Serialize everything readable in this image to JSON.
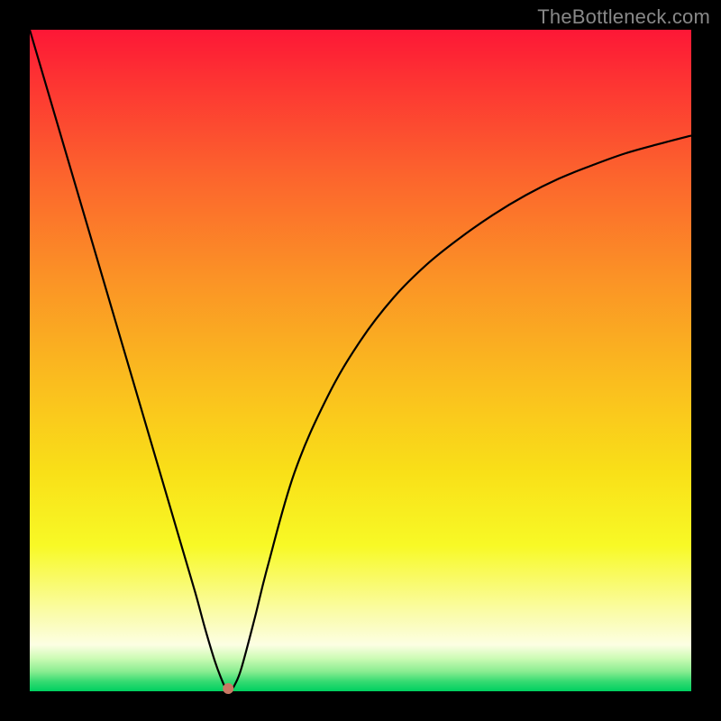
{
  "watermark": "TheBottleneck.com",
  "chart_data": {
    "type": "line",
    "title": "",
    "xlabel": "",
    "ylabel": "",
    "xlim": [
      0,
      1
    ],
    "ylim": [
      0,
      1
    ],
    "series": [
      {
        "name": "bottleneck-curve",
        "x": [
          0.0,
          0.05,
          0.1,
          0.15,
          0.2,
          0.225,
          0.25,
          0.265,
          0.28,
          0.29,
          0.295,
          0.3,
          0.305,
          0.31,
          0.32,
          0.34,
          0.36,
          0.4,
          0.45,
          0.5,
          0.55,
          0.6,
          0.65,
          0.7,
          0.75,
          0.8,
          0.85,
          0.9,
          0.95,
          1.0
        ],
        "y": [
          1.0,
          0.83,
          0.66,
          0.49,
          0.32,
          0.235,
          0.15,
          0.095,
          0.045,
          0.018,
          0.007,
          0.0,
          0.003,
          0.01,
          0.035,
          0.11,
          0.19,
          0.33,
          0.445,
          0.53,
          0.595,
          0.645,
          0.685,
          0.72,
          0.75,
          0.775,
          0.795,
          0.813,
          0.827,
          0.84
        ]
      }
    ],
    "minimum_marker": {
      "x": 0.3,
      "y": 0.0
    },
    "gradient_stops": [
      {
        "pos": 0.0,
        "color": "#fd1736"
      },
      {
        "pos": 0.5,
        "color": "#fac71f"
      },
      {
        "pos": 0.9,
        "color": "#fcfee3"
      },
      {
        "pos": 1.0,
        "color": "#00d060"
      }
    ]
  }
}
